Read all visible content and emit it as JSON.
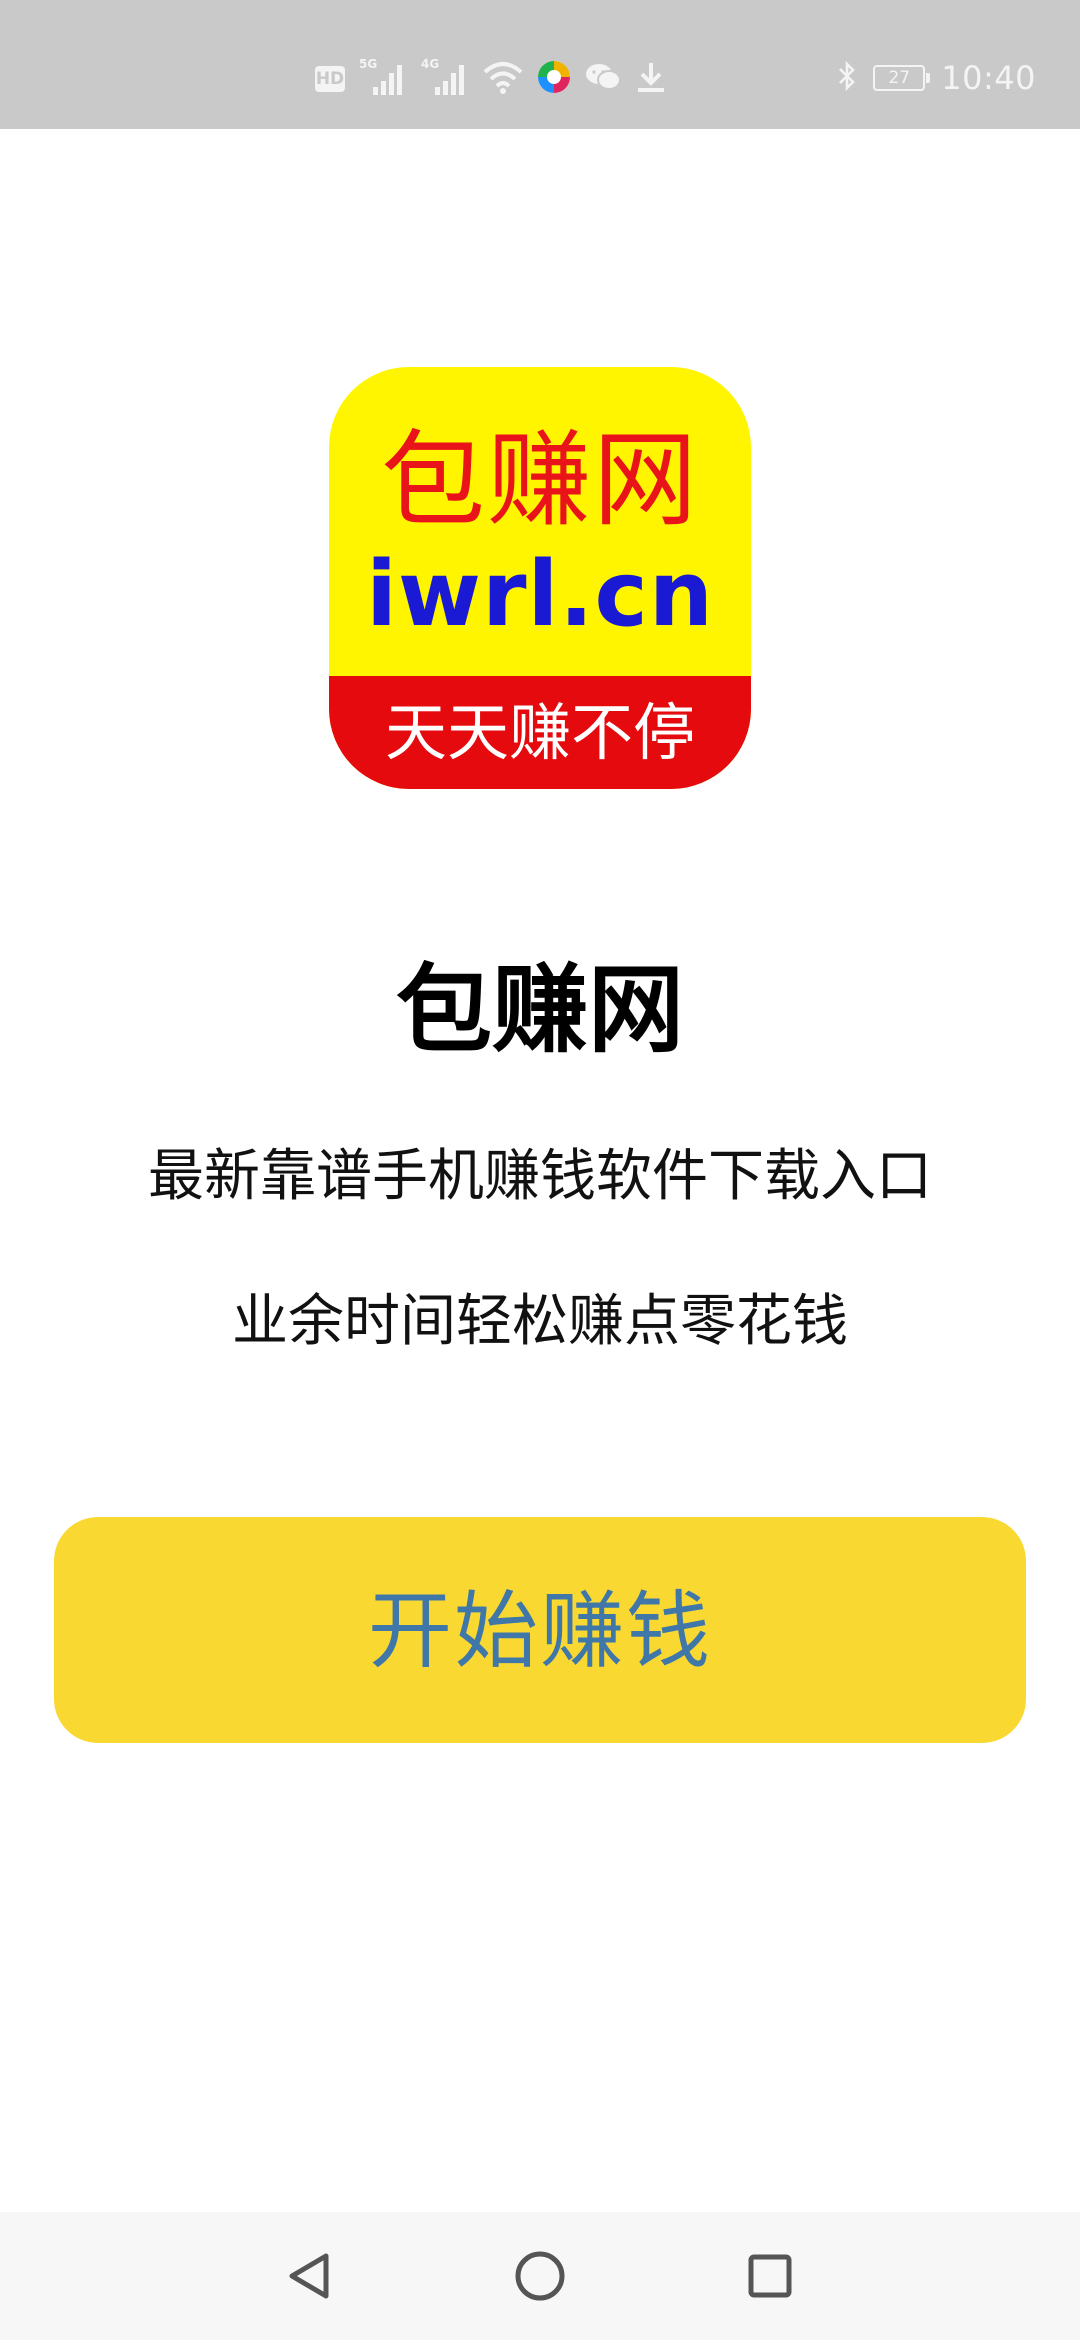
{
  "status_bar": {
    "hd_label": "HD",
    "net1_label": "5G",
    "net2_label": "4G",
    "battery_level": "27",
    "time": "10:40",
    "icons": [
      "hd-icon",
      "signal-5g-icon",
      "signal-4g-icon",
      "wifi-icon",
      "app-notification-icon",
      "wechat-icon",
      "download-icon",
      "bluetooth-icon",
      "battery-icon"
    ]
  },
  "logo": {
    "line1": "包赚网",
    "line2": "iwrl.cn",
    "line3": "天天赚不停",
    "colors": {
      "background": "#fff500",
      "line1": "#e8141a",
      "line2": "#1a1ad4",
      "banner": "#e40a0e"
    }
  },
  "main": {
    "title": "包赚网",
    "tagline1": "最新靠谱手机赚钱软件下载入口",
    "tagline2": "业余时间轻松赚点零花钱",
    "start_button": "开始赚钱",
    "button_color": "#fad832",
    "button_text_color": "#3f77a8"
  },
  "nav_bar": {
    "icons": [
      "back-icon",
      "home-icon",
      "recents-icon"
    ]
  }
}
